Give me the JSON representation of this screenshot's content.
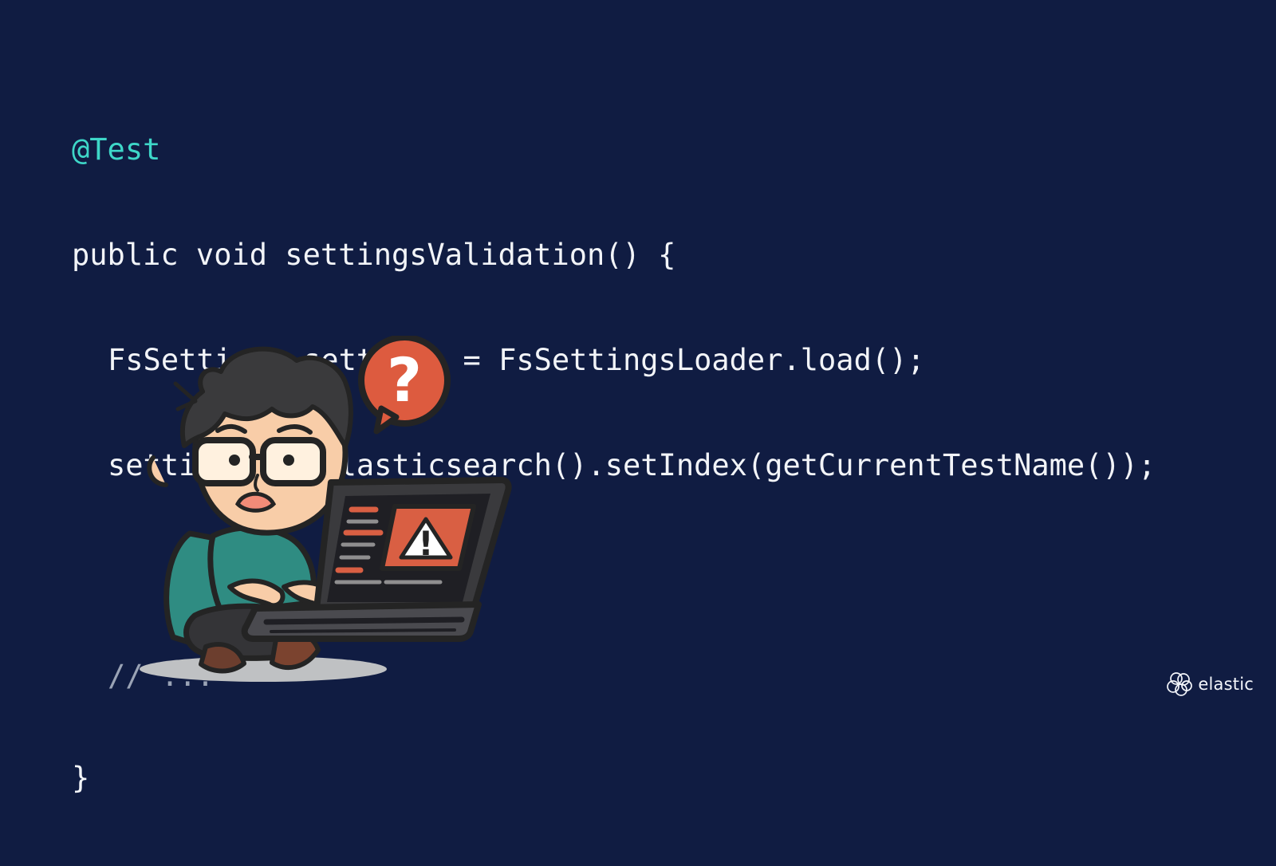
{
  "code": {
    "annotation": "@Test",
    "lines": [
      "public void settingsValidation() {",
      "FsSettings settings = FsSettingsLoader.load();",
      "settings.getElasticsearch().setIndex(getCurrentTestName());",
      "// ...",
      "}"
    ]
  },
  "illustration": {
    "question_symbol": "?",
    "warning_symbol": "!"
  },
  "brand": {
    "name": "elastic",
    "icon": "elastic-logo-icon"
  },
  "colors": {
    "background": "#101c42",
    "code_text": "#f2f4f8",
    "annotation": "#3ed7c8",
    "comment": "#9aa3b5",
    "alert_red": "#d95f43",
    "shirt": "#2f8c82"
  }
}
